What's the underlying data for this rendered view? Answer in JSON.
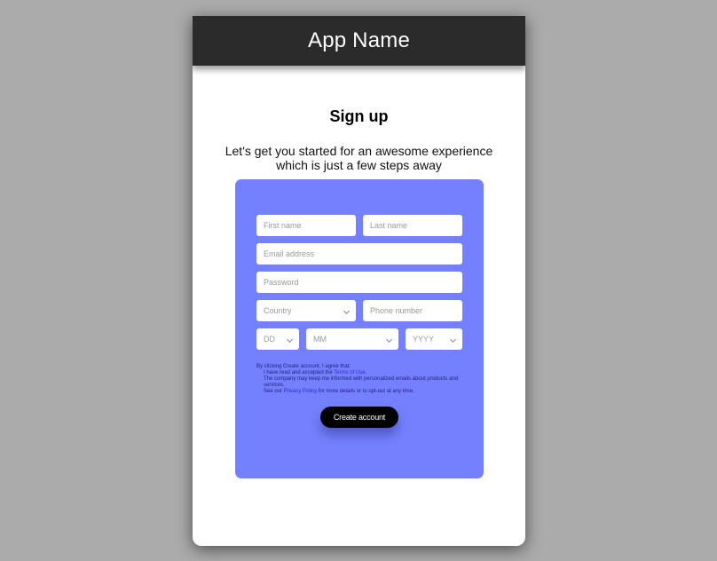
{
  "header": {
    "app_title": "App Name"
  },
  "page": {
    "title": "Sign up",
    "subtitle": "Let's get you started for an awesome experience which is just a few steps away"
  },
  "colors": {
    "header_bg": "#2b2b2b",
    "form_card_bg": "#7480ff",
    "button_bg": "#000000",
    "link": "#2b2bdd",
    "page_bg": "#ababab"
  },
  "form": {
    "first_name": {
      "placeholder": "First name",
      "value": ""
    },
    "last_name": {
      "placeholder": "Last name",
      "value": ""
    },
    "email": {
      "placeholder": "Email address",
      "value": ""
    },
    "password": {
      "placeholder": "Password",
      "value": ""
    },
    "country": {
      "selected": "Country",
      "icon": "chevron-down-icon"
    },
    "phone": {
      "placeholder": "Phone number",
      "value": ""
    },
    "dob_day": {
      "selected": "DD",
      "icon": "chevron-down-icon"
    },
    "dob_month": {
      "selected": "MM",
      "icon": "chevron-down-icon"
    },
    "dob_year": {
      "selected": "YYYY",
      "icon": "chevron-down-icon"
    },
    "terms": {
      "intro": "By clicking Create account, I agree that:",
      "line1_prefix": "I have read and accepted the ",
      "terms_link": "Terms of Use.",
      "line2": "The company may keep me informed with personalized  emails about products and services.",
      "line3_prefix": "See our ",
      "privacy_link": "Privacy Policy",
      "line3_suffix": " for more details or to opt-out at any time."
    },
    "submit_label": "Create account"
  }
}
